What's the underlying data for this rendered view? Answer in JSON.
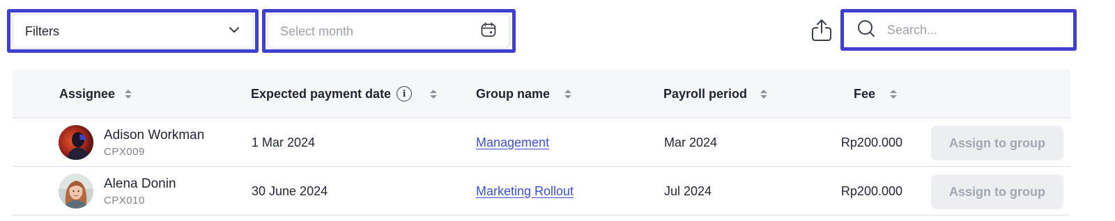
{
  "toolbar": {
    "filters_label": "Filters",
    "month_placeholder": "Select month",
    "search_placeholder": "Search..."
  },
  "table": {
    "columns": [
      {
        "label": "Assignee"
      },
      {
        "label": "Expected payment date"
      },
      {
        "label": "Group name"
      },
      {
        "label": "Payroll period"
      },
      {
        "label": "Fee"
      }
    ],
    "rows": [
      {
        "name": "Adison Workman",
        "code": "CPX009",
        "date": "1 Mar 2024",
        "group": "Management",
        "period": "Mar 2024",
        "fee": "Rp200.000",
        "action": "Assign to group"
      },
      {
        "name": "Alena Donin",
        "code": "CPX010",
        "date": "30 June 2024",
        "group": "Marketing Rollout",
        "period": "Jul 2024",
        "fee": "Rp200.000",
        "action": "Assign to group"
      }
    ]
  },
  "colors": {
    "highlight": "#3f3fd0",
    "link": "#3b4fd8",
    "header_bg": "#f6f7f9",
    "button_disabled_bg": "#eceef1"
  }
}
